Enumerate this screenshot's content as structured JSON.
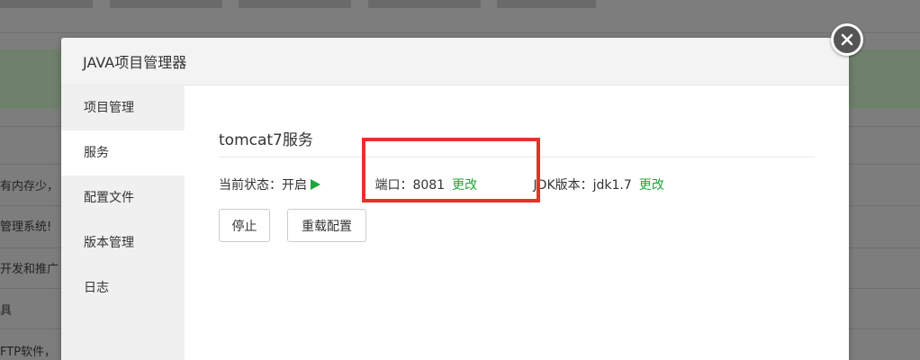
{
  "background": {
    "rows": [
      "有内存少，",
      "管理系统!",
      "开发和推广",
      "具",
      "FTP软件，"
    ]
  },
  "modal": {
    "title": "JAVA项目管理器",
    "sidebar": {
      "items": [
        {
          "label": "项目管理"
        },
        {
          "label": "服务"
        },
        {
          "label": "配置文件"
        },
        {
          "label": "版本管理"
        },
        {
          "label": "日志"
        }
      ]
    },
    "service": {
      "title": "tomcat7服务",
      "status_label": "当前状态：开启",
      "port_label": "端口：8081",
      "port_change": "更改",
      "jdk_label": "JDK版本：jdk1.7",
      "jdk_change": "更改",
      "stop_button": "停止",
      "reload_button": "重载配置"
    }
  },
  "colors": {
    "accent": "#20a53a",
    "highlight": "#e8302b"
  },
  "icons": {
    "close": "close-icon",
    "play": "play-icon"
  }
}
